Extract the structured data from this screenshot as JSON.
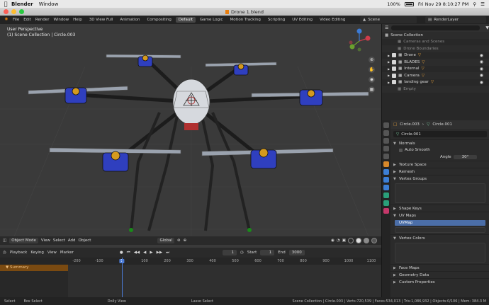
{
  "macbar": {
    "app": "Blender",
    "menus": [
      "Window"
    ],
    "battery": "100%",
    "clock": "Fri Nov 29  8:10:27 PM"
  },
  "window": {
    "title": "Drone 1.blend"
  },
  "topbar": {
    "menus": [
      "File",
      "Edit",
      "Render",
      "Window",
      "Help"
    ],
    "workspaces": [
      "3D View Full",
      "Animation",
      "Compositing",
      "Default",
      "Game Logic",
      "Motion Tracking",
      "Scripting",
      "UV Editing",
      "Video Editing"
    ],
    "active_workspace": "Default",
    "scene": "Scene",
    "render_layer": "RenderLayer"
  },
  "viewport": {
    "view_name": "User Perspective",
    "collection_info": "(1) Scene Collection | Circle.003",
    "header": {
      "mode": "Object Mode",
      "menus": [
        "View",
        "Select",
        "Add",
        "Object"
      ],
      "transform": "Global"
    },
    "gizmo_axes": [
      "X",
      "Y",
      "Z"
    ]
  },
  "timeline": {
    "menus": [
      "Playback",
      "Keying",
      "View",
      "Marker"
    ],
    "current_frame": "1",
    "start_label": "Start",
    "start": "1",
    "end_label": "End",
    "end": "3000",
    "ruler": [
      "-200",
      "-100",
      "1",
      "100",
      "200",
      "300",
      "400",
      "500",
      "600",
      "700",
      "800",
      "900",
      "1000",
      "1100"
    ],
    "summary_label": "Summary"
  },
  "statusbar": {
    "items": [
      "Select",
      "Box Select",
      "Dolly View",
      "Lasso Select"
    ],
    "stats": "Scene Collection | Circle.003 | Verts:720,539 | Faces:534,013 | Tris:1,086,932 | Objects:0/106 | Mem: 384.3 M"
  },
  "outliner": {
    "root": "Scene Collection",
    "rows": [
      {
        "label": "Cameras and Scenes",
        "dim": true
      },
      {
        "label": "Drone Boundaries",
        "dim": true
      },
      {
        "label": "Drone",
        "dim": false
      },
      {
        "label": "BLADES",
        "dim": false
      },
      {
        "label": "Internal",
        "dim": false
      },
      {
        "label": "Camera",
        "dim": false
      },
      {
        "label": "landing gear",
        "dim": false
      },
      {
        "label": "Empty",
        "dim": true
      }
    ]
  },
  "properties": {
    "object": "Circle.003",
    "data": "Circle.001",
    "mesh_name": "Circle.001",
    "sections": {
      "normals": "Normals",
      "auto_smooth": "Auto Smooth",
      "angle_label": "Angle",
      "angle_value": "30°",
      "texture_space": "Texture Space",
      "remesh": "Remesh",
      "vertex_groups": "Vertex Groups",
      "shape_keys": "Shape Keys",
      "uv_maps": "UV Maps",
      "uvmap": "UVMap",
      "vertex_colors": "Vertex Colors",
      "face_maps": "Face Maps",
      "geometry_data": "Geometry Data",
      "custom_properties": "Custom Properties"
    }
  },
  "colors": {
    "accent": "#e87d0d",
    "selection": "#4b7bd6",
    "frame_blue": "#2f3fbf"
  }
}
